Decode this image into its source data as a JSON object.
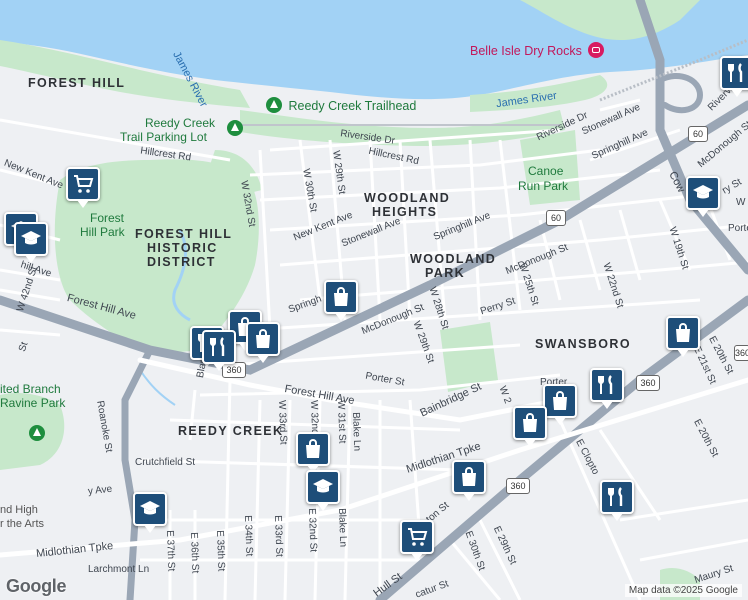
{
  "colors": {
    "water": "#a2d2f5",
    "park": "#c7e8cb",
    "highway": "#9aa6b5",
    "road": "#ffffff",
    "pin": "#1e4e79"
  },
  "neighborhoods": {
    "forest_hill": "FOREST HILL",
    "woodland_heights_1": "WOODLAND",
    "woodland_heights_2": "HEIGHTS",
    "woodland_park_1": "WOODLAND",
    "woodland_park_2": "PARK",
    "swansboro": "SWANSBORO",
    "reedy_creek": "REEDY CREEK",
    "fh_historic_1": "FOREST HILL",
    "fh_historic_2": "HISTORIC",
    "fh_historic_3": "DISTRICT"
  },
  "water_labels": {
    "james_river_left": "James River",
    "james_river_right": "James River"
  },
  "places": {
    "belle_isle": "Belle Isle Dry Rocks",
    "reedy_creek_trailhead": "Reedy Creek Trailhead",
    "trail_parking_1": "Reedy Creek",
    "trail_parking_2": "Trail Parking Lot",
    "forest_hill_park_1": "Forest",
    "forest_hill_park_2": "Hill Park",
    "canoe_run_1": "Canoe",
    "canoe_run_2": "Run Park",
    "ravine_park_1": "ited Branch",
    "ravine_park_2": "Ravine Park",
    "school_1": "nd High",
    "school_2": "r the Arts"
  },
  "streets": {
    "hillcrest_rd_w": "Hillcrest Rd",
    "hillcrest_rd_e": "Hillcrest Rd",
    "riverside_dr": "Riverside Dr",
    "riverside_dr_e": "Riverside Dr",
    "new_kent_ave_w": "New Kent Ave",
    "new_kent_ave": "New Kent Ave",
    "stonewall_ave": "Stonewall Ave",
    "stonewall_ave_e": "Stonewall Ave",
    "springhill_ave": "Springhill Ave",
    "springhill_ave_e": "Springhill Ave",
    "springh": "Springh",
    "mcdonough_st": "McDonough St",
    "mcdonough_st_mid": "McDonough St",
    "mcdonough_st_e": "McDonough St",
    "perry_st": "Perry St",
    "porter_st": "Porter St",
    "porter_st_e": "Porter",
    "forest_hill_ave_w": "Forest Hill Ave",
    "forest_hill_ave": "Forest Hill Ave",
    "bainbridge_st": "Bainbridge St",
    "crutchfield_st": "Crutchfield St",
    "midlothian_tpke_w": "Midlothian Tpke",
    "midlothian_tpke_e": "Midlothian Tpke",
    "larchmont_ln": "Larchmont Ln",
    "roanoke_st": "Roanoke St",
    "bland_st": "Bland St",
    "w_32nd": "W 32nd St",
    "w_30th": "W 30th St",
    "w_29th": "W 29th St",
    "w_28th": "W 28th St",
    "w_29th_s": "W 29th St",
    "w_25th": "W 25th St",
    "w_22nd": "W 22nd St",
    "w_19th": "W 19th St",
    "w_42nd": "W 42nd St",
    "w_33rd": "W 33rd St",
    "w_32nd_s": "W 32nd St",
    "w_31st": "W 31st St",
    "blake_ln": "Blake Ln",
    "blake_ln_s": "Blake Ln",
    "e_37th": "E 37th St",
    "e_36th": "E 36th St",
    "e_35th": "E 35th St",
    "e_34th": "E 34th St",
    "e_33rd": "E 33rd St",
    "e_32nd": "E 32nd St",
    "e_30th": "E 30th St",
    "e_29th": "E 29th St",
    "e_20th": "E 20th St",
    "e_21st": "E 21st St",
    "e_20th_s": "E 20th St",
    "maury_st": "Maury St",
    "e_clopton": "E Clopto",
    "hull_st": "Hull St",
    "decatur": "catur St",
    "cowardin": "Cow",
    "riverview_pkwy": "Riverview Pkwy",
    "porter_e": "Porte",
    "ry_st": "ry St",
    "w_17": "W 1",
    "kent_ave_frag": "hill Ave",
    "ton_st": "ton St",
    "w_20": "W 2",
    "st_42": "St",
    "ave_frag": "y Ave"
  },
  "route_shields": [
    "60",
    "60",
    "360",
    "360",
    "360",
    "360"
  ],
  "map_pins": [
    {
      "kind": "grocery",
      "icon": "cart-icon"
    },
    {
      "kind": "school",
      "icon": "graduation-cap-icon"
    },
    {
      "kind": "shopping",
      "icon": "shopping-bag-icon"
    },
    {
      "kind": "restaurant",
      "icon": "fork-knife-icon"
    },
    {
      "kind": "shopping",
      "icon": "shopping-bag-icon"
    },
    {
      "kind": "school",
      "icon": "graduation-cap-icon"
    },
    {
      "kind": "restaurant",
      "icon": "fork-knife-icon"
    },
    {
      "kind": "shopping",
      "icon": "shopping-bag-icon"
    },
    {
      "kind": "shopping",
      "icon": "shopping-bag-icon"
    },
    {
      "kind": "restaurant",
      "icon": "fork-knife-icon"
    },
    {
      "kind": "shopping",
      "icon": "shopping-bag-icon"
    },
    {
      "kind": "school",
      "icon": "graduation-cap-icon"
    },
    {
      "kind": "shopping",
      "icon": "shopping-bag-icon"
    },
    {
      "kind": "restaurant",
      "icon": "fork-knife-icon"
    },
    {
      "kind": "school",
      "icon": "graduation-cap-icon"
    },
    {
      "kind": "grocery",
      "icon": "cart-icon"
    },
    {
      "kind": "restaurant",
      "icon": "fork-knife-icon"
    },
    {
      "kind": "school",
      "icon": "graduation-cap-icon"
    }
  ],
  "branding": {
    "logo": "Google",
    "attribution": "Map data ©2025 Google"
  }
}
